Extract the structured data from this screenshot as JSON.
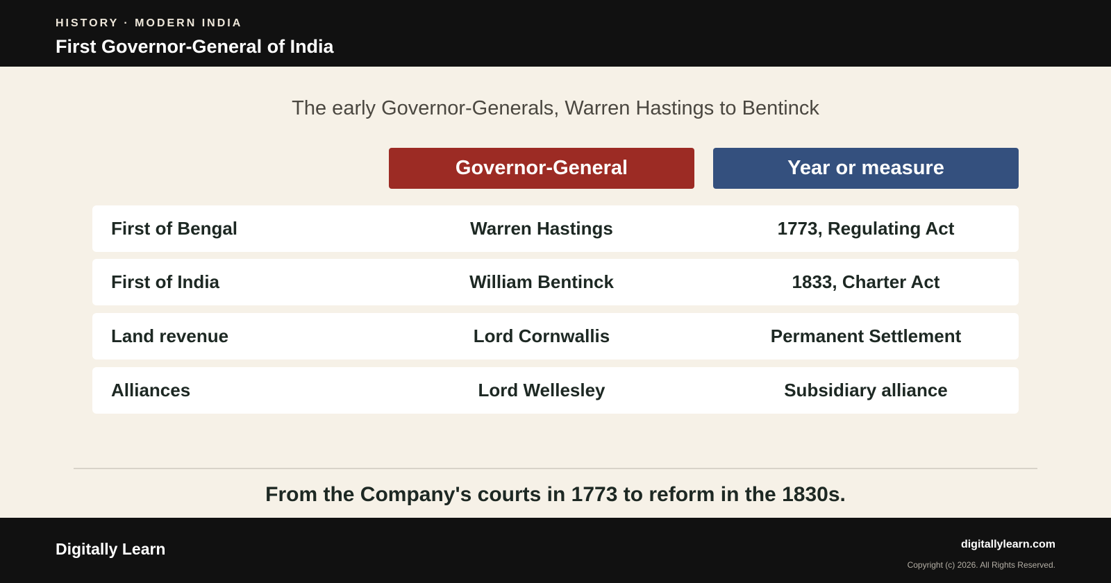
{
  "header": {
    "eyebrow": "HISTORY · MODERN INDIA",
    "title": "First Governor-General of India"
  },
  "main": {
    "subtitle": "The early Governor-Generals, Warren Hastings to Bentinck",
    "columns": [
      "Governor-General",
      "Year or measure"
    ],
    "rows": [
      {
        "label": "First of Bengal",
        "person": "Warren Hastings",
        "measure": "1773, Regulating Act"
      },
      {
        "label": "First of India",
        "person": "William Bentinck",
        "measure": "1833, Charter Act"
      },
      {
        "label": "Land revenue",
        "person": "Lord Cornwallis",
        "measure": "Permanent Settlement"
      },
      {
        "label": "Alliances",
        "person": "Lord Wellesley",
        "measure": "Subsidiary alliance"
      }
    ],
    "caption": "From the Company's courts in 1773 to reform in the 1830s."
  },
  "footer": {
    "brand": "Digitally Learn",
    "site": "digitallylearn.com",
    "copyright": "Copyright (c) 2026. All Rights Reserved."
  },
  "colors": {
    "topbar": "#111111",
    "background": "#f6f1e7",
    "governor_header": "#9c2b24",
    "measure_header": "#34507e"
  }
}
